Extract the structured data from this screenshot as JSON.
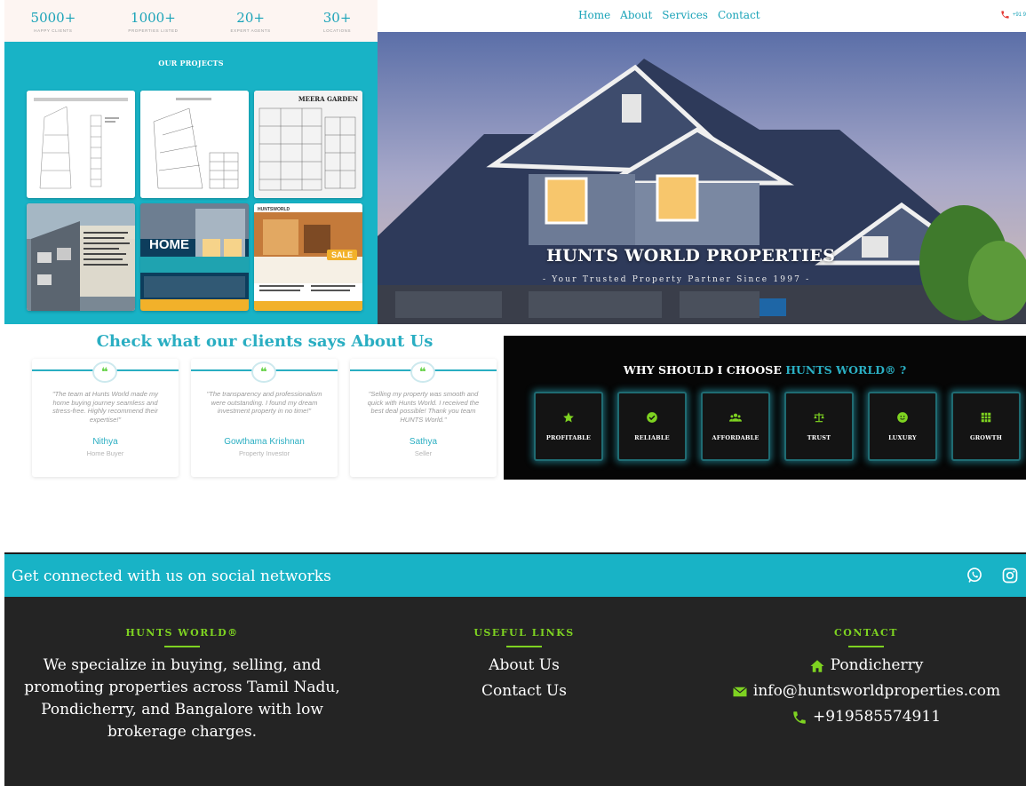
{
  "stats": [
    {
      "value": "5000+",
      "label": "HAPPY CLIENTS"
    },
    {
      "value": "1000+",
      "label": "PROPERTIES LISTED"
    },
    {
      "value": "20+",
      "label": "EXPERT AGENTS"
    },
    {
      "value": "30+",
      "label": "LOCATIONS"
    }
  ],
  "nav": {
    "links": [
      "Home",
      "About",
      "Services",
      "Contact"
    ],
    "phone": "+91 9"
  },
  "projects": {
    "title": "OUR PROJECTS",
    "cards": [
      {
        "type": "layout-plan"
      },
      {
        "type": "layout-plan"
      },
      {
        "type": "layout-plan",
        "label": "MEERA GARDEN"
      },
      {
        "type": "photo-flyer"
      },
      {
        "type": "sale-flyer",
        "heading": "HOME",
        "badge": "SALE"
      },
      {
        "type": "sale-flyer",
        "brand": "HUNTSWORLD",
        "badge": "SALE"
      }
    ]
  },
  "hero": {
    "title": "HUNTS WORLD PROPERTIES",
    "subtitle": "- Your Trusted Property Partner Since 1997 -"
  },
  "testimonials": {
    "title": "Check what our clients says About Us",
    "items": [
      {
        "text": "\"The team at Hunts World made my home buying journey seamless and stress-free. Highly recommend their expertise!\"",
        "name": "Nithya",
        "role": "Home Buyer"
      },
      {
        "text": "\"The transparency and professionalism were outstanding. I found my dream investment property in no time!\"",
        "name": "Gowthama Krishnan",
        "role": "Property Investor"
      },
      {
        "text": "\"Selling my property was smooth and quick with Hunts World. I received the best deal possible! Thank you team HUNTS World.\"",
        "name": "Sathya",
        "role": "Seller"
      }
    ]
  },
  "why": {
    "title_prefix": "WHY SHOULD I CHOOSE",
    "title_accent": "HUNTS WORLD® ?",
    "items": [
      {
        "label": "PROFITABLE",
        "icon": "star-icon"
      },
      {
        "label": "RELIABLE",
        "icon": "check-circle-icon"
      },
      {
        "label": "AFFORDABLE",
        "icon": "users-icon"
      },
      {
        "label": "TRUST",
        "icon": "balance-scale-icon"
      },
      {
        "label": "LUXURY",
        "icon": "smile-icon"
      },
      {
        "label": "GROWTH",
        "icon": "grid-icon"
      }
    ],
    "accent_color": "#2aaec2",
    "icon_color": "#7ed321"
  },
  "social": {
    "text": "Get connected with us on social networks",
    "icons": [
      "whatsapp-icon",
      "instagram-icon"
    ]
  },
  "footer": {
    "about": {
      "heading": "HUNTS WORLD®",
      "lines": [
        "We specialize in buying, selling, and",
        "promoting properties across Tamil Nadu,",
        "Pondicherry, and Bangalore with low",
        "brokerage charges."
      ]
    },
    "links": {
      "heading": "USEFUL LINKS",
      "items": [
        "About Us",
        "Contact Us"
      ]
    },
    "contact": {
      "heading": "CONTACT",
      "address": "Pondicherry",
      "email": "info@huntsworldproperties.com",
      "phone": "+919585574911"
    }
  },
  "colors": {
    "teal": "#18b3c6",
    "green": "#7ed321",
    "dark": "#242424"
  }
}
